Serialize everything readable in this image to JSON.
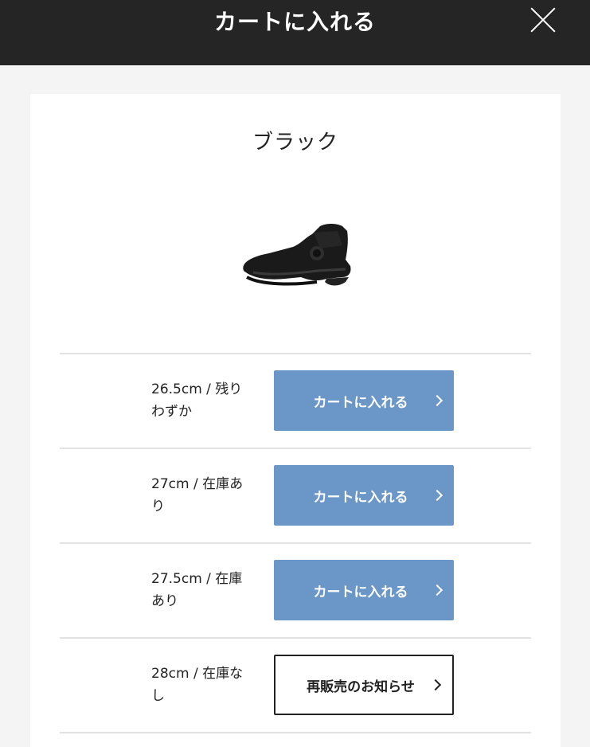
{
  "header": {
    "title": "カートに入れる"
  },
  "product": {
    "color_name": "ブラック"
  },
  "sizes": [
    {
      "label_line1": "26.5cm / 残り",
      "label_line2": "わずか",
      "button": "カートに入れる"
    },
    {
      "label_line1": "27cm / 在庫あ",
      "label_line2": "り",
      "button": "カートに入れる"
    },
    {
      "label_line1": "27.5cm / 在庫",
      "label_line2": "あり",
      "button": "カートに入れる"
    },
    {
      "label_line1": "28cm / 在庫な",
      "label_line2": "し",
      "button": "再販売のお知らせ"
    }
  ],
  "colors": {
    "header_bg": "#252525",
    "cart_button": "#6b96c8",
    "page_bg": "#f4f4f4"
  }
}
